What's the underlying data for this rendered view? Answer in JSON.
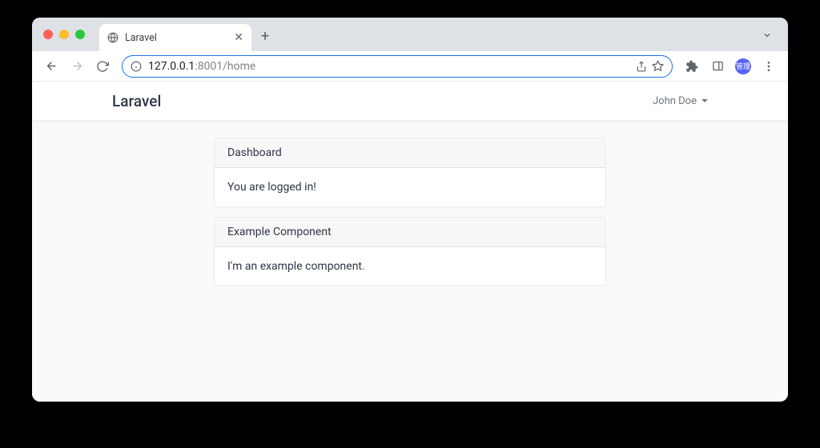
{
  "browser": {
    "tab_title": "Laravel",
    "url_host": "127.0.0.1",
    "url_port_path": ":8001/home",
    "profile_label": "管理"
  },
  "app": {
    "brand": "Laravel",
    "user_name": "John Doe"
  },
  "cards": [
    {
      "header": "Dashboard",
      "body": "You are logged in!"
    },
    {
      "header": "Example Component",
      "body": "I'm an example component."
    }
  ]
}
